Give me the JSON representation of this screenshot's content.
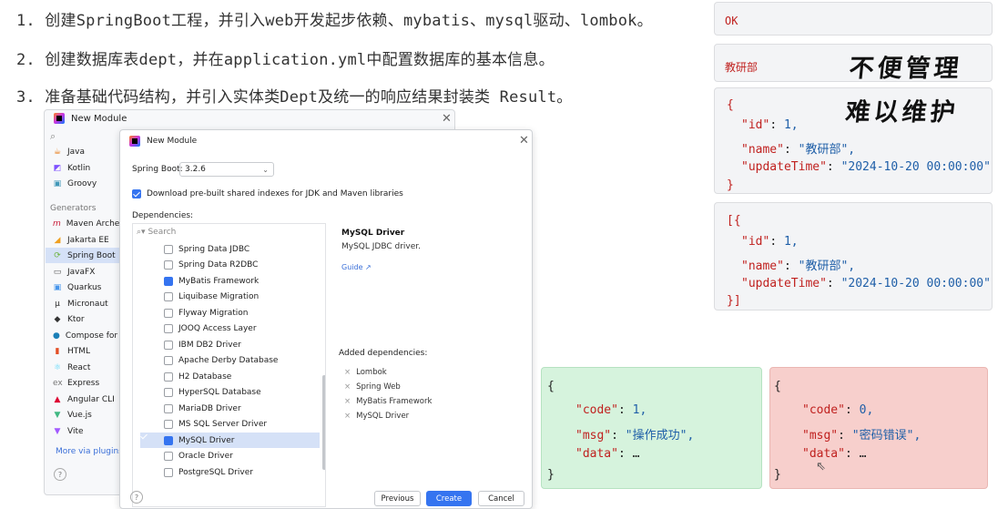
{
  "steps": [
    "1. 创建SpringBoot工程，并引入web开发起步依赖、mybatis、mysql驱动、lombok。",
    "2. 创建数据库表dept，并在application.yml中配置数据库的基本信息。",
    "3. 准备基础代码结构，并引入实体类Dept及统一的响应结果封装类 Result。"
  ],
  "outer_dialog": {
    "title": "New Module",
    "search_icon": "search-icon",
    "languages": [
      {
        "label": "Java",
        "icon": "java-icon"
      },
      {
        "label": "Kotlin",
        "icon": "kotlin-icon"
      },
      {
        "label": "Groovy",
        "icon": "groovy-icon"
      }
    ],
    "generators_label": "Generators",
    "generators": [
      {
        "label": "Maven Archetype",
        "icon": "maven-icon"
      },
      {
        "label": "Jakarta EE",
        "icon": "jakarta-icon"
      },
      {
        "label": "Spring Boot",
        "icon": "spring-boot-icon"
      },
      {
        "label": "JavaFX",
        "icon": "javafx-icon"
      },
      {
        "label": "Quarkus",
        "icon": "quarkus-icon"
      },
      {
        "label": "Micronaut",
        "icon": "micronaut-icon"
      },
      {
        "label": "Ktor",
        "icon": "ktor-icon"
      },
      {
        "label": "Compose for Desktop",
        "icon": "compose-icon"
      },
      {
        "label": "HTML",
        "icon": "html-icon"
      },
      {
        "label": "React",
        "icon": "react-icon"
      },
      {
        "label": "Express",
        "icon": "express-icon"
      },
      {
        "label": "Angular CLI",
        "icon": "angular-icon"
      },
      {
        "label": "Vue.js",
        "icon": "vue-icon"
      },
      {
        "label": "Vite",
        "icon": "vite-icon"
      }
    ],
    "more_plugins": "More via plugins...",
    "help": "?"
  },
  "inner_dialog": {
    "title": "New Module",
    "spring_boot_label": "Spring Boot:",
    "spring_boot_version": "3.2.6",
    "download_indexes": "Download pre-built shared indexes for JDK and Maven libraries",
    "dependencies_label": "Dependencies:",
    "search_placeholder": "Search",
    "dependencies": [
      {
        "label": "Spring Data JDBC",
        "checked": false
      },
      {
        "label": "Spring Data R2DBC",
        "checked": false
      },
      {
        "label": "MyBatis Framework",
        "checked": true
      },
      {
        "label": "Liquibase Migration",
        "checked": false
      },
      {
        "label": "Flyway Migration",
        "checked": false
      },
      {
        "label": "JOOQ Access Layer",
        "checked": false
      },
      {
        "label": "IBM DB2 Driver",
        "checked": false
      },
      {
        "label": "Apache Derby Database",
        "checked": false
      },
      {
        "label": "H2 Database",
        "checked": false
      },
      {
        "label": "HyperSQL Database",
        "checked": false
      },
      {
        "label": "MariaDB Driver",
        "checked": false
      },
      {
        "label": "MS SQL Server Driver",
        "checked": false
      },
      {
        "label": "MySQL Driver",
        "checked": true
      },
      {
        "label": "Oracle Driver",
        "checked": false
      },
      {
        "label": "PostgreSQL Driver",
        "checked": false
      }
    ],
    "detail_title": "MySQL Driver",
    "detail_desc": "MySQL JDBC driver.",
    "guide_link": "Guide ↗",
    "added_title": "Added dependencies:",
    "added": [
      "Lombok",
      "Spring Web",
      "MyBatis Framework",
      "MySQL Driver"
    ],
    "remove_glyph": "×",
    "help": "?",
    "btn_previous": "Previous",
    "btn_create": "Create",
    "btn_cancel": "Cancel"
  },
  "cards": {
    "ok": "OK",
    "dept_name_plain": "教研部",
    "brush_1": "不便管理",
    "brush_2": "难以维护",
    "obj_open": "{",
    "obj_close": "}",
    "arr_open": "[{",
    "arr_close": "}]",
    "id_key": "\"id\"",
    "id_val": "1,",
    "name_key": "\"name\"",
    "name_val": "\"教研部\",",
    "update_key": "\"updateTime\"",
    "update_val": "\"2024-10-20 00:00:00\"",
    "colon": ": "
  },
  "result_success": {
    "open": "{",
    "code_key": "\"code\"",
    "code_val": "1,",
    "msg_key": "\"msg\"",
    "msg_val": "\"操作成功\",",
    "data_key": "\"data\"",
    "data_val": "…",
    "close": "}"
  },
  "result_error": {
    "open": "{",
    "code_key": "\"code\"",
    "code_val": "0,",
    "msg_key": "\"msg\"",
    "msg_val": "\"密码错误\",",
    "data_key": "\"data\"",
    "data_val": "…",
    "close": "}"
  },
  "colors": {
    "accent": "#3574f0",
    "json_key": "#c0211f",
    "json_value": "#1f5fa8",
    "success_bg": "#d6f3dd",
    "error_bg": "#f7cfcc"
  }
}
